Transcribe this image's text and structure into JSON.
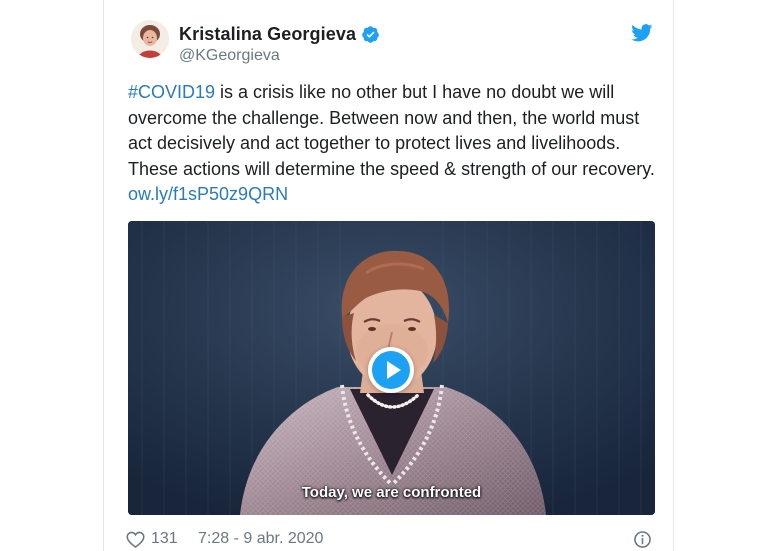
{
  "author": {
    "name": "Kristalina Georgieva",
    "handle": "@KGeorgieva"
  },
  "tweet": {
    "hashtag": "#COVID19",
    "body": " is a crisis like no other but I have no doubt we will overcome the challenge. Between now and then, the world must act decisively and act together to protect lives and livelihoods. These actions will determine the speed & strength of our recovery. ",
    "link": "ow.ly/f1sP50z9QRN"
  },
  "video": {
    "caption": "Today, we are confronted"
  },
  "footer": {
    "likes": "131",
    "timestamp": "7:28 - 9 abr. 2020"
  },
  "colors": {
    "link": "#2b7bb9",
    "brand": "#1da1f2",
    "text": "#1c2022",
    "muted": "#697882"
  },
  "icons": {
    "verified": "verified-badge-icon",
    "brand": "twitter-bird-icon",
    "like": "heart-icon",
    "info": "info-icon",
    "play": "play-icon"
  }
}
